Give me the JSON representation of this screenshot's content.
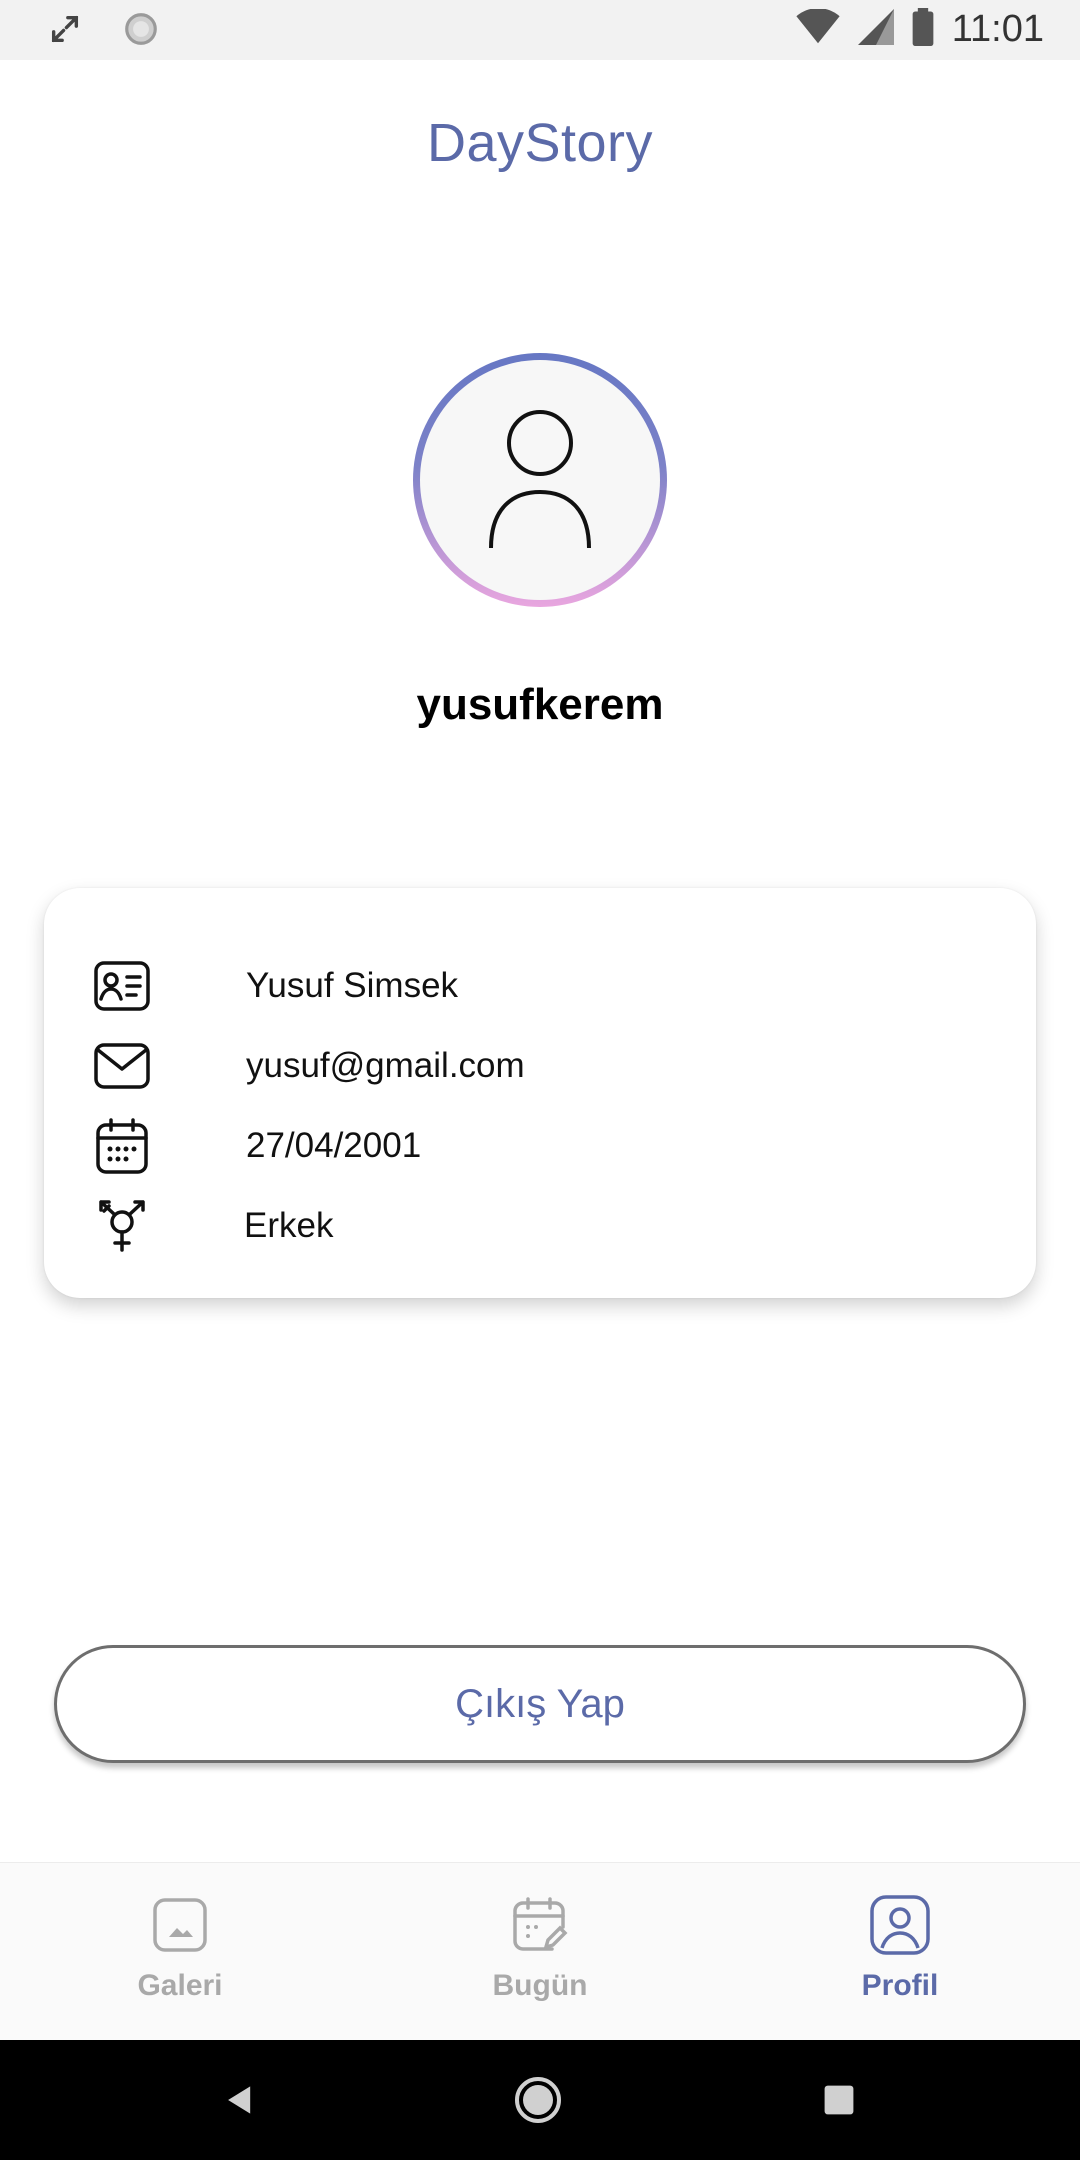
{
  "status_bar": {
    "time": "11:01",
    "icons": [
      "expand-arrows-icon",
      "loading-circle-icon",
      "wifi-icon",
      "signal-icon",
      "battery-icon"
    ]
  },
  "header": {
    "title": "DayStory"
  },
  "profile": {
    "username": "yusufkerem",
    "full_name": "Yusuf Simsek",
    "email": "yusuf@gmail.com",
    "birth_date": "27/04/2001",
    "gender": "Erkek"
  },
  "actions": {
    "logout_label": "Çıkış Yap"
  },
  "bottom_nav": {
    "items": [
      {
        "label": "Galeri",
        "icon": "gallery-icon",
        "active": false
      },
      {
        "label": "Bugün",
        "icon": "calendar-edit-icon",
        "active": false
      },
      {
        "label": "Profil",
        "icon": "profile-icon",
        "active": true
      }
    ]
  },
  "colors": {
    "accent": "#5b6aa8",
    "inactive": "#a9a9a9",
    "avatar_gradient_top": "#6677c4",
    "avatar_gradient_bottom": "#e9a6df"
  }
}
